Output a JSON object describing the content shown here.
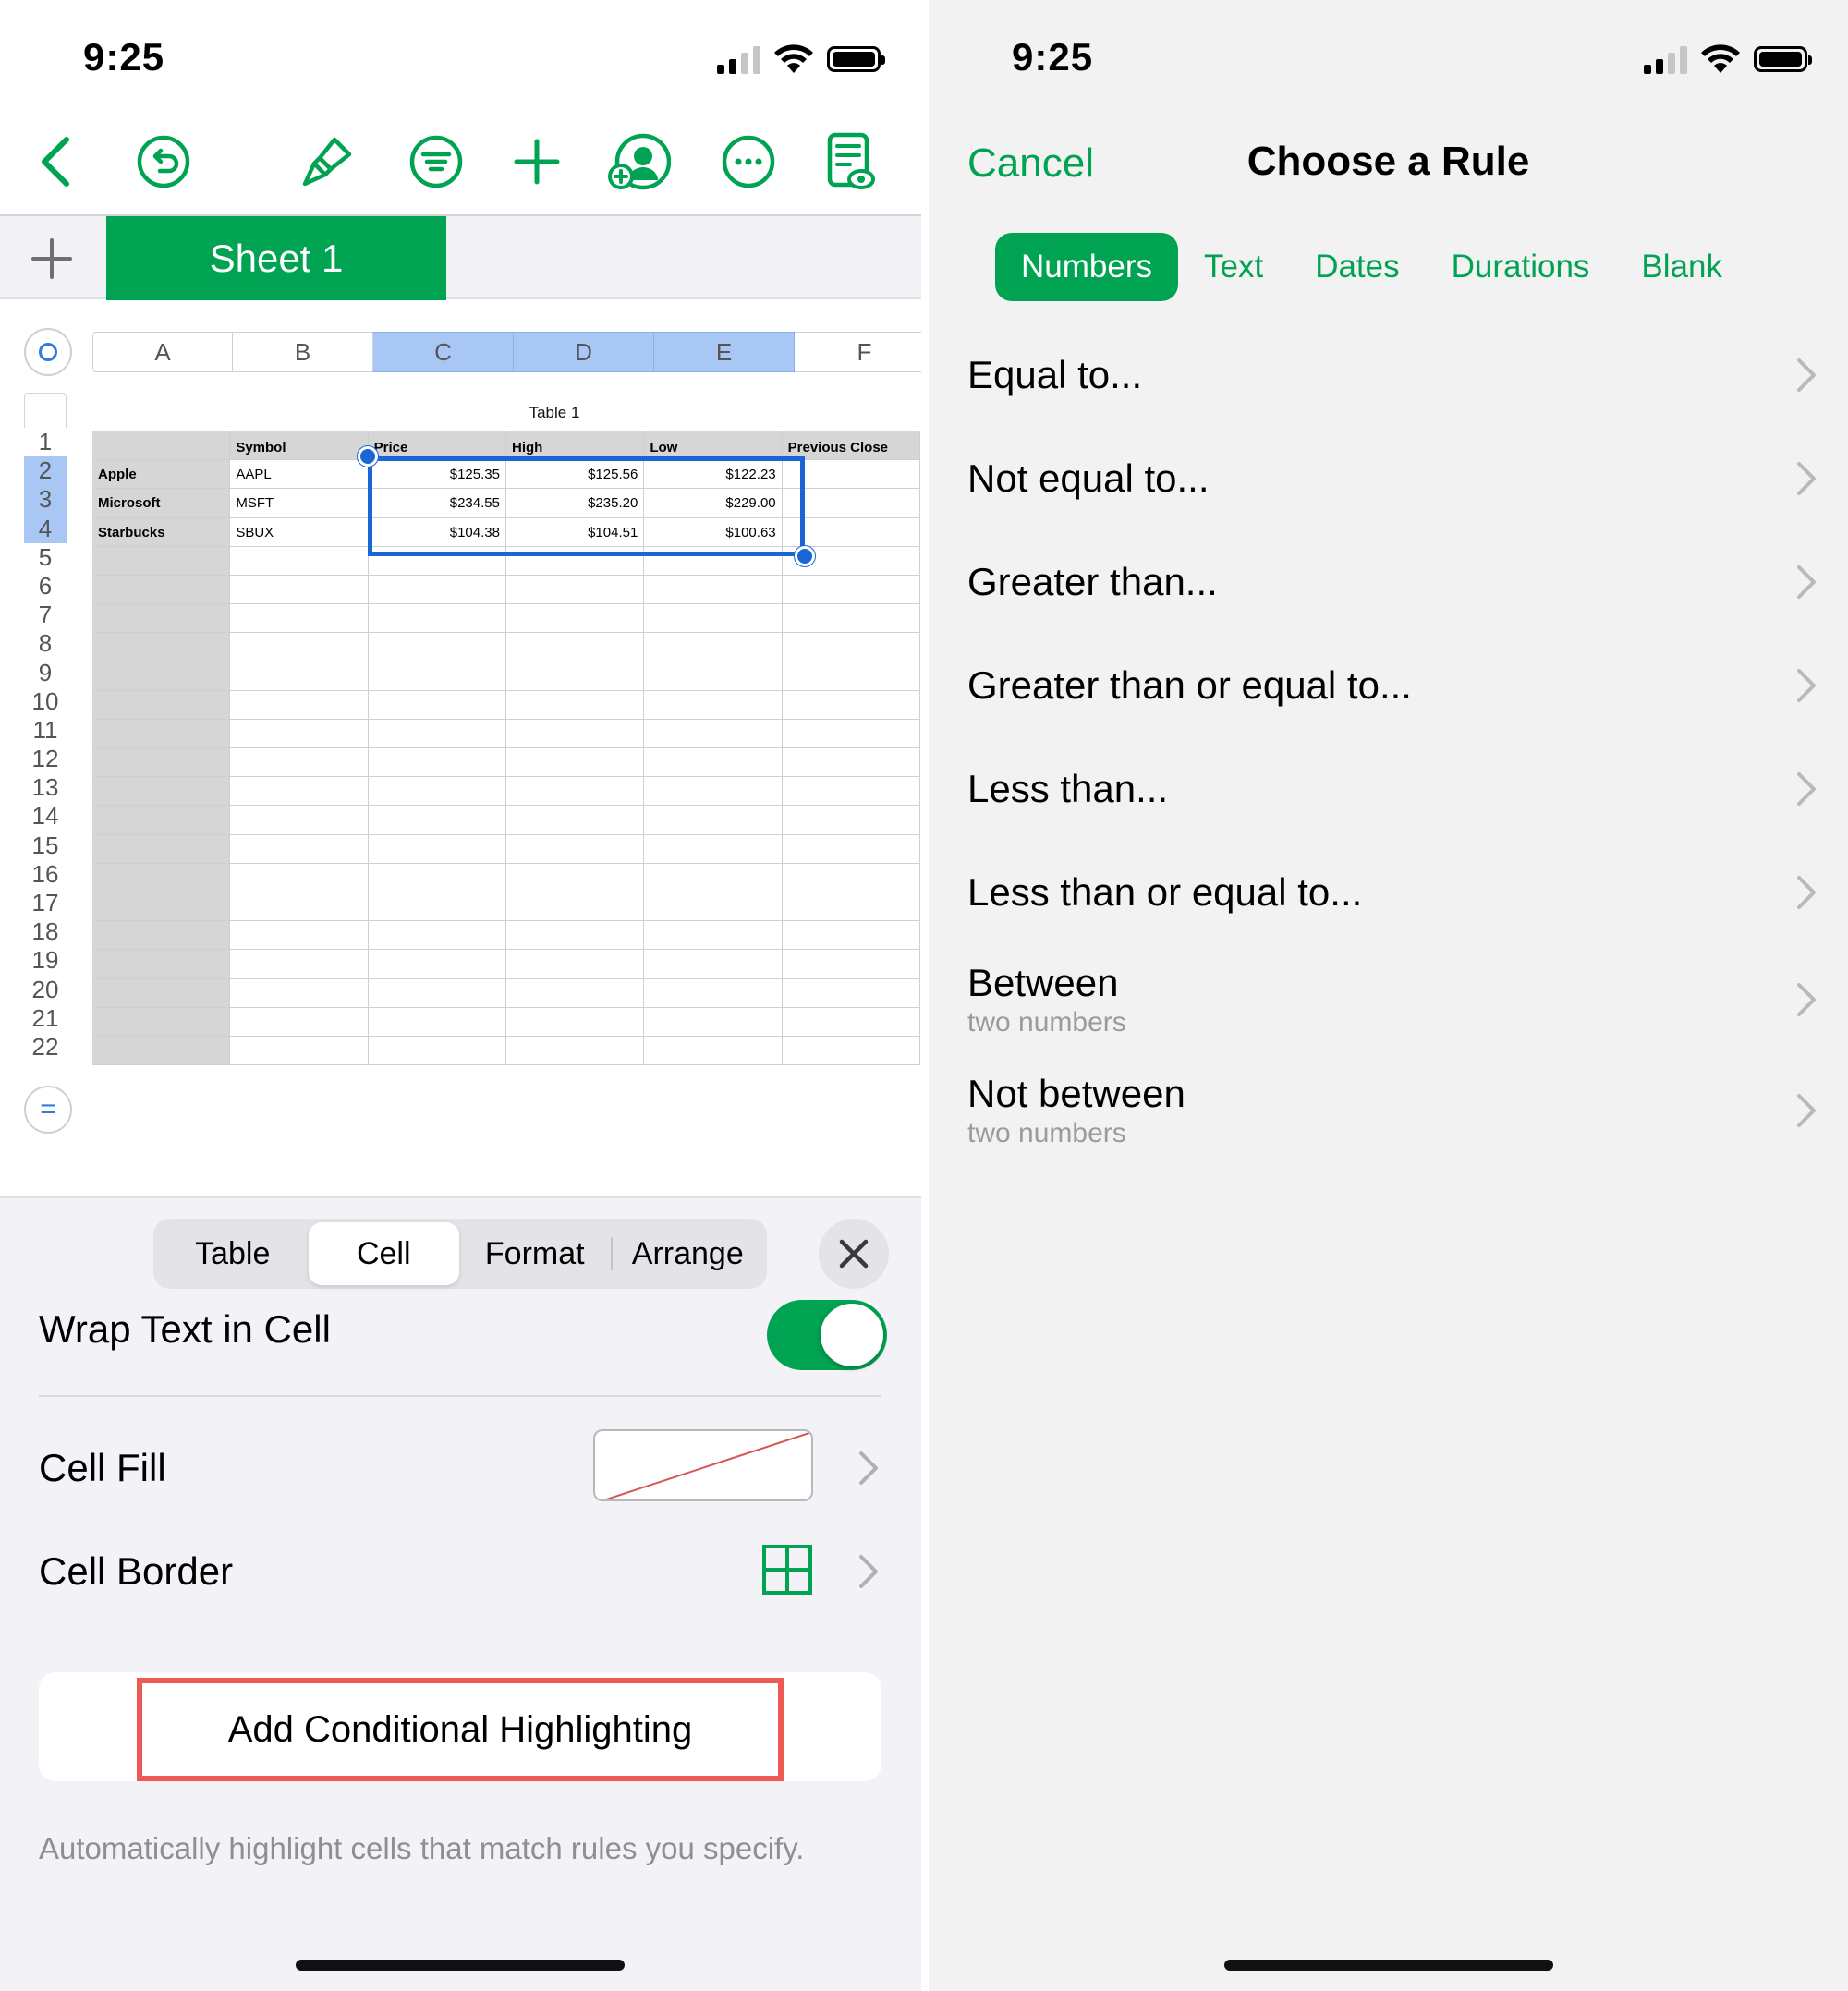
{
  "left": {
    "status": {
      "time": "9:25"
    },
    "sheet_tab": "Sheet 1",
    "columns": [
      "A",
      "B",
      "C",
      "D",
      "E",
      "F"
    ],
    "selected_columns": [
      "C",
      "D",
      "E"
    ],
    "rows": [
      "1",
      "2",
      "3",
      "4",
      "5",
      "6",
      "7",
      "8",
      "9",
      "10",
      "11",
      "12",
      "13",
      "14",
      "15",
      "16",
      "17",
      "18",
      "19",
      "20",
      "21",
      "22"
    ],
    "selected_rows": [
      "2",
      "3",
      "4"
    ],
    "table": {
      "title": "Table 1",
      "headers": [
        "",
        "Symbol",
        "Price",
        "High",
        "Low",
        "Previous Close"
      ],
      "data": [
        [
          "Apple",
          "AAPL",
          "$125.35",
          "$125.56",
          "$122.23",
          ""
        ],
        [
          "Microsoft",
          "MSFT",
          "$234.55",
          "$235.20",
          "$229.00",
          ""
        ],
        [
          "Starbucks",
          "SBUX",
          "$104.38",
          "$104.51",
          "$100.63",
          ""
        ]
      ]
    },
    "segments": [
      "Table",
      "Cell",
      "Format",
      "Arrange"
    ],
    "active_segment": "Cell",
    "wrap_text_label": "Wrap Text in Cell",
    "wrap_text_on": true,
    "cell_fill_label": "Cell Fill",
    "cell_border_label": "Cell Border",
    "conditional_button": "Add Conditional Highlighting",
    "conditional_note": "Automatically highlight cells that match rules you specify.",
    "accent": "#00a352",
    "highlight_outline": "#ec5a53"
  },
  "right": {
    "status": {
      "time": "9:25"
    },
    "cancel": "Cancel",
    "title": "Choose a Rule",
    "tabs": [
      "Numbers",
      "Text",
      "Dates",
      "Durations",
      "Blank"
    ],
    "active_tab": "Numbers",
    "rules": [
      {
        "title": "Equal to...",
        "sub": ""
      },
      {
        "title": "Not equal to...",
        "sub": ""
      },
      {
        "title": "Greater than...",
        "sub": ""
      },
      {
        "title": "Greater than or equal to...",
        "sub": ""
      },
      {
        "title": "Less than...",
        "sub": ""
      },
      {
        "title": "Less than or equal to...",
        "sub": ""
      },
      {
        "title": "Between",
        "sub": "two numbers"
      },
      {
        "title": "Not between",
        "sub": "two numbers"
      }
    ]
  }
}
